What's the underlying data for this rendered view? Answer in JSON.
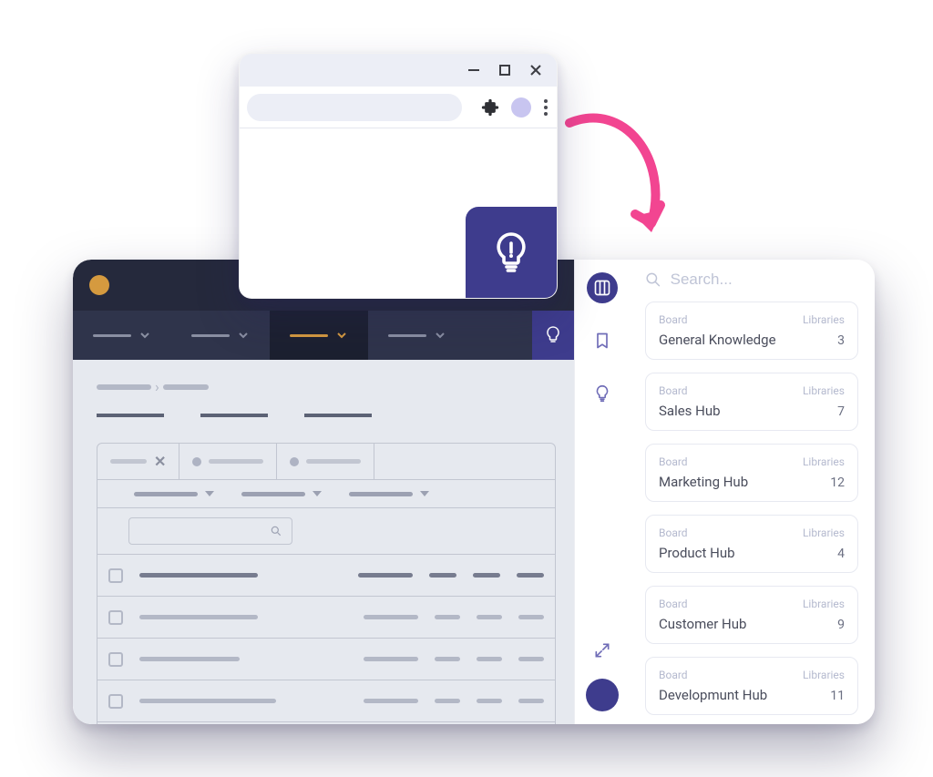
{
  "colors": {
    "brand": "#3E3C8D",
    "accent": "#D59A3F",
    "pink": "#F24591",
    "rail_stroke": "#6F6CB7",
    "text_muted": "#B4B9CE"
  },
  "browser": {
    "window_buttons": {
      "minimize": "minimize",
      "maximize": "maximize",
      "close": "close"
    },
    "toolbar_icons": {
      "puzzle": "extensions-icon",
      "more": "more-icon"
    }
  },
  "sidebar_rail": {
    "items": [
      {
        "name": "boards-icon",
        "active": true
      },
      {
        "name": "bookmark-icon",
        "active": false
      },
      {
        "name": "lightbulb-icon",
        "active": false
      }
    ],
    "bottom": {
      "expand": "expand-icon",
      "avatar": "user-avatar"
    }
  },
  "search": {
    "placeholder": "Search..."
  },
  "board_labels": {
    "board": "Board",
    "libraries": "Libraries"
  },
  "boards": [
    {
      "name": "General Knowledge",
      "libraries": 3
    },
    {
      "name": "Sales Hub",
      "libraries": 7
    },
    {
      "name": "Marketing Hub",
      "libraries": 12
    },
    {
      "name": "Product Hub",
      "libraries": 4
    },
    {
      "name": "Customer Hub",
      "libraries": 9
    },
    {
      "name": "Developmunt Hub",
      "libraries": 11
    }
  ]
}
